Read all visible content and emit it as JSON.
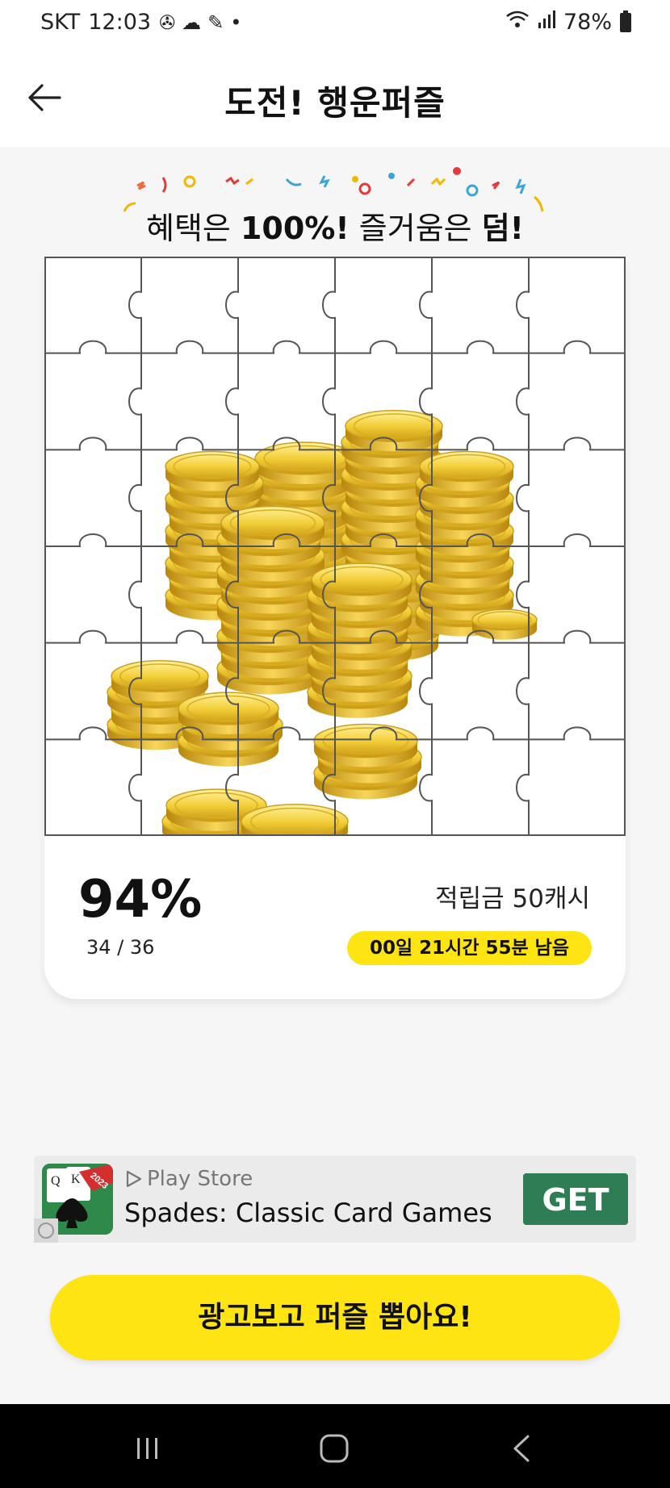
{
  "status_bar": {
    "carrier": "SKT",
    "time": "12:03",
    "battery": "78%"
  },
  "header": {
    "title": "도전! 행운퍼즐"
  },
  "banner": {
    "part1": "혜택은 ",
    "bold1": "100%!",
    "part2": " 즐거움은 ",
    "bold2": "덤!"
  },
  "progress": {
    "percent": "94%",
    "count": "34 / 36",
    "pieces_done": 34,
    "pieces_total": 36
  },
  "reward": {
    "label": "적립금 50캐시",
    "time_left": "00일 21시간 55분 남음"
  },
  "ad": {
    "store": "Play Store",
    "title": "Spades: Classic Card Games",
    "button": "GET",
    "app_badge": "2023"
  },
  "cta": {
    "label": "광고보고 퍼즐 뽑아요!"
  },
  "icons": [
    "back-arrow-icon",
    "play-store-icon",
    "recents-icon",
    "home-icon",
    "nav-back-icon"
  ],
  "colors": {
    "accent_yellow": "#ffe414",
    "ad_green": "#2e7d55",
    "coin_gold": "#e8b818"
  }
}
